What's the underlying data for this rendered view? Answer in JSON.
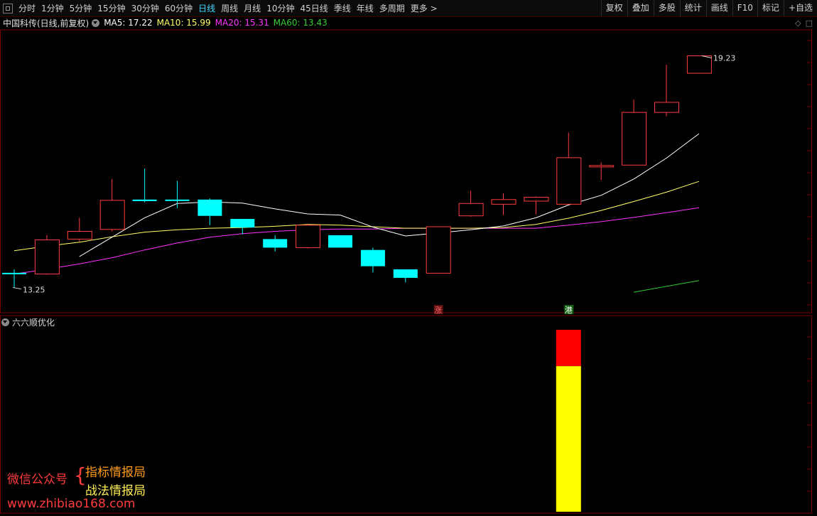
{
  "toolbar": {
    "periods": [
      "分时",
      "1分钟",
      "5分钟",
      "15分钟",
      "30分钟",
      "60分钟",
      "日线",
      "周线",
      "月线",
      "10分钟",
      "45日线",
      "季线",
      "年线",
      "多周期",
      "更多 >"
    ],
    "active_index": 6,
    "tools": [
      "复权",
      "叠加",
      "多股",
      "统计",
      "画线",
      "F10",
      "标记",
      "+自选"
    ]
  },
  "info": {
    "stock": "中国科传(日线,前复权)",
    "ma5": "MA5: 17.22",
    "ma10": "MA10: 15.99",
    "ma20": "MA20: 15.31",
    "ma60": "MA60: 13.43"
  },
  "colors": {
    "up": "#ff3c3c",
    "down": "#00ffff",
    "ma5": "#ffffff",
    "ma10": "#ffff66",
    "ma20": "#ff33ff",
    "ma60": "#33cc33",
    "bar_red": "#ff0000",
    "bar_yellow": "#ffff00"
  },
  "panel_icons": [
    "diamond-icon",
    "square-icon"
  ],
  "indicator": {
    "title": "六六顺优化"
  },
  "watermark": {
    "left": "微信公众号",
    "line1": "指标情报局",
    "line2": "战法情报局",
    "url": "www.zhibiao168.com"
  },
  "chart_data": {
    "type": "candlestick",
    "ylim": [
      12.6,
      19.9
    ],
    "candles": [
      {
        "o": 13.63,
        "c": 13.6,
        "h": 13.72,
        "l": 13.25
      },
      {
        "o": 13.6,
        "c": 14.48,
        "h": 14.6,
        "l": 13.58
      },
      {
        "o": 14.5,
        "c": 14.7,
        "h": 15.05,
        "l": 14.44
      },
      {
        "o": 14.75,
        "c": 15.5,
        "h": 16.05,
        "l": 14.7
      },
      {
        "o": 15.52,
        "c": 15.48,
        "h": 16.32,
        "l": 15.45
      },
      {
        "o": 15.52,
        "c": 15.5,
        "h": 16.0,
        "l": 15.3
      },
      {
        "o": 15.52,
        "c": 15.1,
        "h": 15.55,
        "l": 14.86
      },
      {
        "o": 15.02,
        "c": 14.8,
        "h": 15.02,
        "l": 14.62
      },
      {
        "o": 14.5,
        "c": 14.28,
        "h": 14.6,
        "l": 14.18
      },
      {
        "o": 14.28,
        "c": 14.86,
        "h": 14.9,
        "l": 14.26
      },
      {
        "o": 14.6,
        "c": 14.28,
        "h": 14.6,
        "l": 14.28
      },
      {
        "o": 14.22,
        "c": 13.8,
        "h": 14.28,
        "l": 13.64
      },
      {
        "o": 13.72,
        "c": 13.5,
        "h": 13.72,
        "l": 13.38
      },
      {
        "o": 13.62,
        "c": 14.82,
        "h": 14.82,
        "l": 13.62
      },
      {
        "o": 15.1,
        "c": 15.42,
        "h": 15.75,
        "l": 15.08
      },
      {
        "o": 15.4,
        "c": 15.52,
        "h": 15.68,
        "l": 15.12
      },
      {
        "o": 15.48,
        "c": 15.58,
        "h": 15.6,
        "l": 15.14
      },
      {
        "o": 15.4,
        "c": 16.6,
        "h": 17.25,
        "l": 15.4
      },
      {
        "o": 16.4,
        "c": 16.4,
        "h": 16.48,
        "l": 16.03
      },
      {
        "o": 16.41,
        "c": 17.77,
        "h": 18.1,
        "l": 16.41
      },
      {
        "o": 17.77,
        "c": 18.03,
        "h": 19.0,
        "l": 17.67
      },
      {
        "o": 18.78,
        "c": 19.23,
        "h": 19.23,
        "l": 18.78
      }
    ],
    "ma5": [
      null,
      null,
      14.05,
      14.55,
      15.05,
      15.42,
      15.46,
      15.43,
      15.28,
      15.15,
      15.12,
      14.81,
      14.58,
      14.66,
      14.74,
      14.84,
      15.05,
      15.38,
      15.63,
      16.05,
      16.59,
      17.22
    ],
    "ma10": [
      14.2,
      14.32,
      14.42,
      14.56,
      14.68,
      14.74,
      14.78,
      14.8,
      14.83,
      14.88,
      14.86,
      14.82,
      14.78,
      14.78,
      14.78,
      14.8,
      14.88,
      15.04,
      15.24,
      15.47,
      15.71,
      15.99
    ],
    "ma20": [
      13.6,
      13.72,
      13.86,
      14.02,
      14.22,
      14.4,
      14.55,
      14.64,
      14.7,
      14.74,
      14.76,
      14.76,
      14.78,
      14.78,
      14.78,
      14.78,
      14.78,
      14.86,
      14.95,
      15.06,
      15.18,
      15.31
    ],
    "ma60": [
      null,
      null,
      null,
      null,
      null,
      null,
      null,
      null,
      null,
      null,
      null,
      null,
      null,
      null,
      null,
      null,
      null,
      null,
      null,
      13.13,
      13.28,
      13.43
    ],
    "high_label": "19.23",
    "low_label": "13.25",
    "markers": [
      {
        "index": 13,
        "text": "涨",
        "bg": "#5a1010",
        "color": "#ff6666"
      },
      {
        "index": 17,
        "text": "港",
        "bg": "#106010",
        "color": "#ffffff"
      }
    ],
    "indicator_bars": [
      {
        "index": 17,
        "red": 0.2,
        "yellow": 0.8
      }
    ]
  }
}
